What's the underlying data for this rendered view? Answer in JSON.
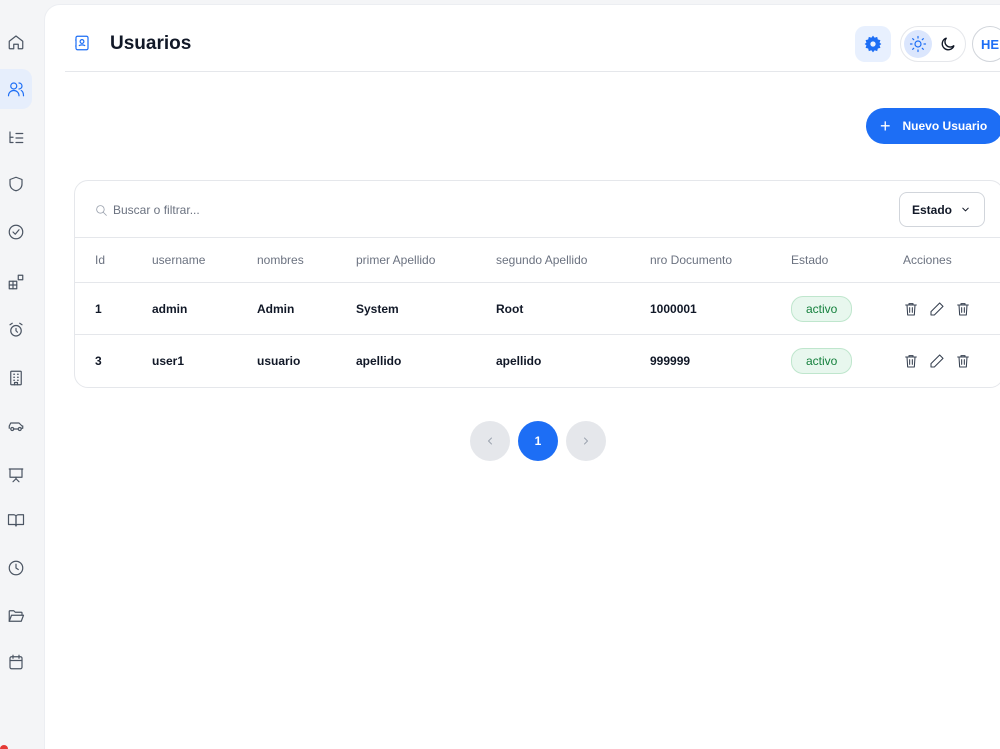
{
  "sidebar": {
    "items": [
      {
        "icon": "home-icon"
      },
      {
        "icon": "users-icon",
        "active": true
      },
      {
        "icon": "list-tree-icon"
      },
      {
        "icon": "shield-icon"
      },
      {
        "icon": "check-circle-icon"
      },
      {
        "icon": "blocks-icon"
      },
      {
        "icon": "alarm-clock-icon"
      },
      {
        "icon": "building-icon"
      },
      {
        "icon": "car-icon"
      },
      {
        "icon": "presentation-icon"
      },
      {
        "icon": "book-open-icon"
      },
      {
        "icon": "clock-icon"
      },
      {
        "icon": "folder-open-icon"
      },
      {
        "icon": "calendar-icon"
      }
    ]
  },
  "header": {
    "title": "Usuarios",
    "avatar_initials": "HE"
  },
  "toolbar": {
    "new_user_label": "Nuevo Usuario"
  },
  "table": {
    "search_placeholder": "Buscar o filtrar...",
    "filter_label": "Estado",
    "columns": [
      "Id",
      "username",
      "nombres",
      "primer Apellido",
      "segundo Apellido",
      "nro Documento",
      "Estado",
      "Acciones"
    ],
    "rows": [
      {
        "id": "1",
        "username": "admin",
        "nombres": "Admin",
        "primer_apellido": "System",
        "segundo_apellido": "Root",
        "nro_documento": "1000001",
        "estado": "activo"
      },
      {
        "id": "3",
        "username": "user1",
        "nombres": "usuario",
        "primer_apellido": "apellido",
        "segundo_apellido": "apellido",
        "nro_documento": "999999",
        "estado": "activo"
      }
    ]
  },
  "pagination": {
    "current_page": "1"
  },
  "colors": {
    "primary": "#1d6ef5",
    "status_active_bg": "#e8f7ee",
    "status_active_text": "#15803d"
  }
}
